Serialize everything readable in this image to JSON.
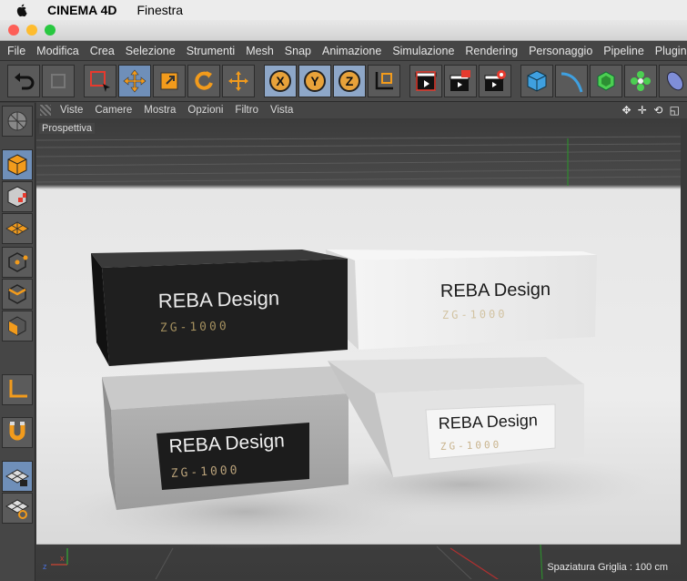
{
  "macbar": {
    "app_name": "CINEMA 4D",
    "menu_item": "Finestra"
  },
  "menubar": {
    "items": [
      "File",
      "Modifica",
      "Crea",
      "Selezione",
      "Strumenti",
      "Mesh",
      "Snap",
      "Animazione",
      "Simulazione",
      "Rendering",
      "Personaggio",
      "Pipeline",
      "Plugin"
    ]
  },
  "toolbar": {
    "axis_x": "X",
    "axis_y": "Y",
    "axis_z": "Z"
  },
  "viewport": {
    "menu": [
      "Viste",
      "Camere",
      "Mostra",
      "Opzioni",
      "Filtro",
      "Vista"
    ],
    "nav_icons": "✥ ✛ ⟲ ◱",
    "camera_label": "Prospettiva",
    "grid_spacing": "Spaziatura Griglia : 100 cm",
    "axis_label_z": "z",
    "axis_label_x": "x"
  },
  "scene": {
    "boxes": [
      {
        "brand": "REBA Design",
        "model": "ZG-1000",
        "color": "black"
      },
      {
        "brand": "REBA Design",
        "model": "ZG-1000",
        "color": "white"
      },
      {
        "brand": "REBA Design",
        "model": "ZG-1000",
        "color": "grey"
      },
      {
        "brand": "REBA Design",
        "model": "ZG-1000",
        "color": "light-grey"
      }
    ]
  },
  "colors": {
    "accent_blue": "#6f8fb9",
    "toolbar_bg": "#4a4a4a",
    "axis_orange": "#f29b1c"
  }
}
